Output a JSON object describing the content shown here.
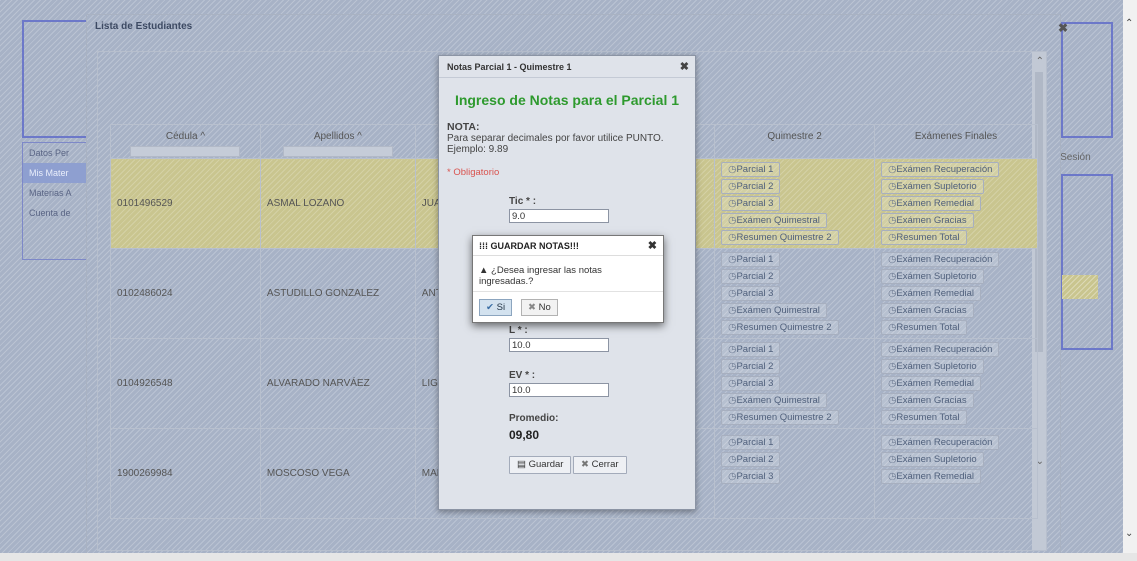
{
  "background": {
    "sidebar_items": [
      "Datos Per",
      "Mis Mater",
      "Materias A",
      "Cuenta de"
    ],
    "logout_text": "r Sesión"
  },
  "main_window": {
    "title": "Lista de Estudiantes",
    "columns": [
      "Cédula ^",
      "Apellidos ^",
      "",
      "Quimestre 2",
      "Exámenes Finales"
    ],
    "rows": [
      {
        "cedula": "0101496529",
        "apellidos": "ASMAL LOZANO",
        "nombres": "JUA"
      },
      {
        "cedula": "0102486024",
        "apellidos": "ASTUDILLO GONZALEZ",
        "nombres": "ANT"
      },
      {
        "cedula": "0104926548",
        "apellidos": "ALVARADO NARVÁEZ",
        "nombres": "LIGI"
      },
      {
        "cedula": "1900269984",
        "apellidos": "MOSCOSO VEGA",
        "nombres": "MAF"
      }
    ],
    "quimestre2_links": [
      "Parcial 1",
      "Parcial 2",
      "Parcial 3",
      "Exámen Quimestral",
      "Resumen Quimestre 2"
    ],
    "finales_links": [
      "Exámen Recuperación",
      "Exámen Supletorio",
      "Exámen Remedial",
      "Exámen Gracias",
      "Resumen Total"
    ]
  },
  "notas_modal": {
    "title": "Notas Parcial 1 - Quimestre 1",
    "heading": "Ingreso de Notas para el Parcial 1",
    "nota_label": "NOTA:",
    "nota_text": "Para separar decimales por favor utilice PUNTO. Ejemplo: 9.89",
    "required_text": "* Obligatorio",
    "fields": [
      {
        "label": "Tic * :",
        "value": "9.0"
      },
      {
        "label": "L * :",
        "value": "10.0"
      },
      {
        "label": "EV * :",
        "value": "10.0"
      }
    ],
    "promedio_label": "Promedio:",
    "promedio_value": "09,80",
    "save_label": "Guardar",
    "close_label": "Cerrar"
  },
  "confirm_dialog": {
    "title": "GUARDAR NOTAS!!!",
    "message": "¿Desea ingresar las notas ingresadas.?",
    "yes_label": "Si",
    "no_label": "No"
  }
}
